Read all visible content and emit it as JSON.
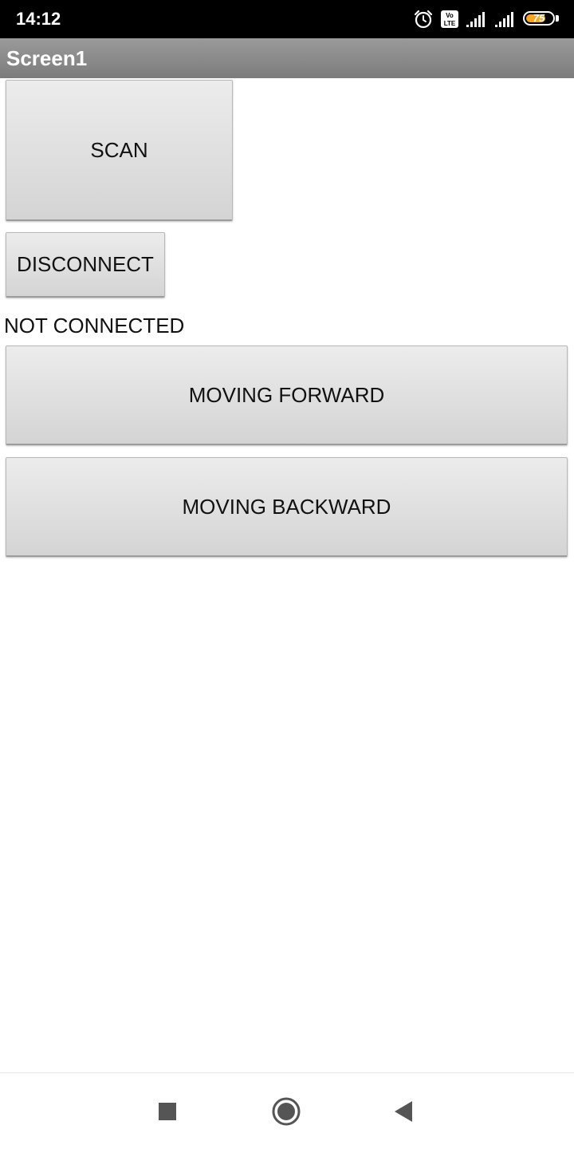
{
  "status_bar": {
    "time": "14:12",
    "icons": [
      "alarm-icon",
      "volte-icon",
      "signal-icon",
      "signal-icon",
      "battery-icon"
    ],
    "battery_level": "75",
    "battery_color": "#f5a623"
  },
  "app": {
    "title": "Screen1"
  },
  "buttons": {
    "scan": "SCAN",
    "disconnect": "DISCONNECT",
    "forward": "MOVING FORWARD",
    "backward": "MOVING BACKWARD"
  },
  "connection_status": "NOT CONNECTED",
  "nav_bar": {
    "icons": [
      "recents-icon",
      "home-icon",
      "back-icon"
    ]
  }
}
